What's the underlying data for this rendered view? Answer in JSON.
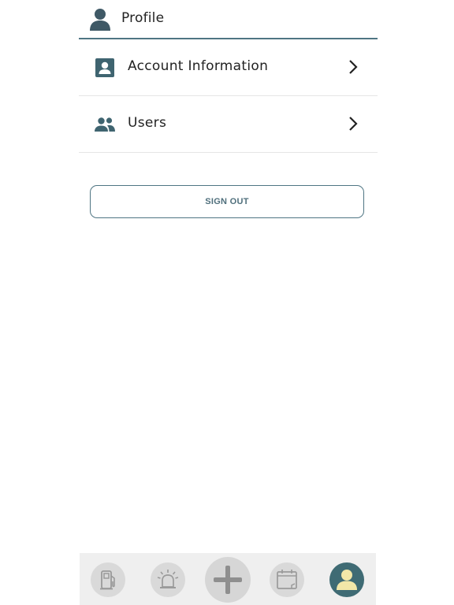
{
  "header": {
    "title": "Profile",
    "icon": "person-icon"
  },
  "menu": {
    "items": [
      {
        "label": "Account Information",
        "icon": "account-box-icon"
      },
      {
        "label": "Users",
        "icon": "people-icon"
      }
    ]
  },
  "actions": {
    "sign_out_label": "SIGN OUT"
  },
  "tabbar": {
    "tabs": [
      {
        "icon": "fuel-pump-icon",
        "active": false
      },
      {
        "icon": "alarm-siren-icon",
        "active": false
      },
      {
        "icon": "plus-icon",
        "active": false
      },
      {
        "icon": "calendar-icon",
        "active": false
      },
      {
        "icon": "profile-icon",
        "active": true
      }
    ]
  },
  "colors": {
    "accent": "#4f7583",
    "active_tab": "#3f6b74",
    "active_icon": "#f2e7a8",
    "inactive_icon": "#9a9a9a",
    "tabbar_bg": "#efefef"
  }
}
